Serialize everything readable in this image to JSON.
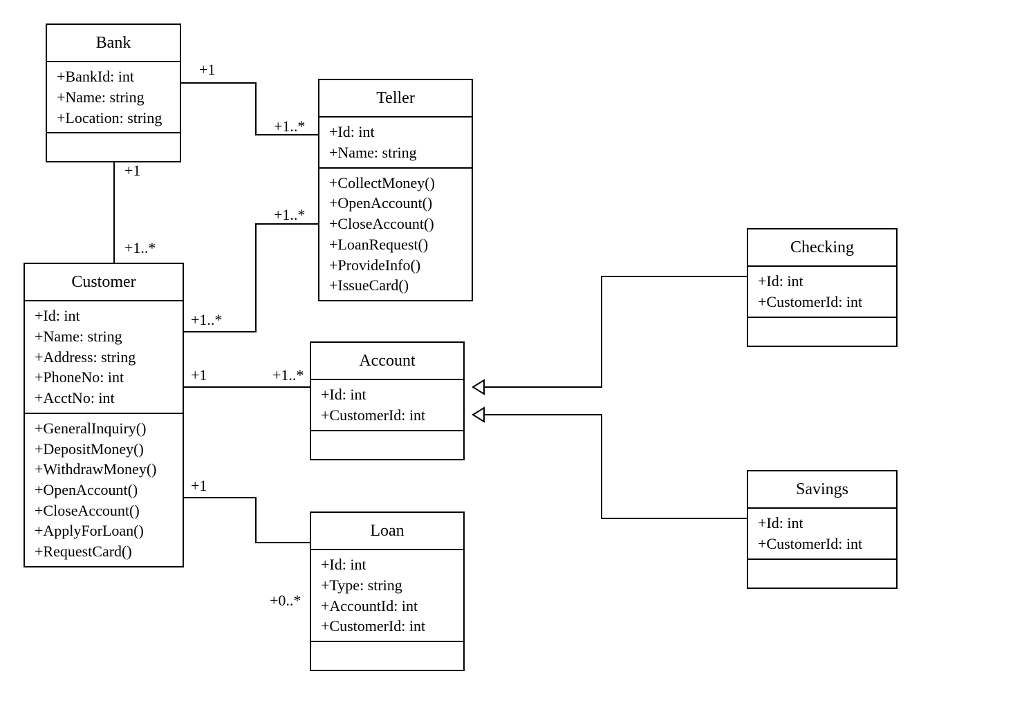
{
  "diagram_type": "UML class diagram",
  "classes": {
    "bank": {
      "name": "Bank",
      "attributes": [
        "+BankId: int",
        "+Name: string",
        "+Location: string"
      ],
      "operations": []
    },
    "teller": {
      "name": "Teller",
      "attributes": [
        "+Id: int",
        "+Name: string"
      ],
      "operations": [
        "+CollectMoney()",
        "+OpenAccount()",
        "+CloseAccount()",
        "+LoanRequest()",
        "+ProvideInfo()",
        "+IssueCard()"
      ]
    },
    "customer": {
      "name": "Customer",
      "attributes": [
        "+Id: int",
        "+Name: string",
        "+Address: string",
        "+PhoneNo: int",
        "+AcctNo: int"
      ],
      "operations": [
        "+GeneralInquiry()",
        "+DepositMoney()",
        "+WithdrawMoney()",
        "+OpenAccount()",
        "+CloseAccount()",
        "+ApplyForLoan()",
        "+RequestCard()"
      ]
    },
    "account": {
      "name": "Account",
      "attributes": [
        "+Id: int",
        "+CustomerId: int"
      ],
      "operations": []
    },
    "loan": {
      "name": "Loan",
      "attributes": [
        "+Id: int",
        "+Type: string",
        "+AccountId: int",
        "+CustomerId: int"
      ],
      "operations": []
    },
    "checking": {
      "name": "Checking",
      "attributes": [
        "+Id: int",
        "+CustomerId: int"
      ],
      "operations": []
    },
    "savings": {
      "name": "Savings",
      "attributes": [
        "+Id: int",
        "+CustomerId: int"
      ],
      "operations": []
    }
  },
  "multiplicities": {
    "bank_teller_bank": "+1",
    "bank_teller_teller": "+1..*",
    "bank_customer_bank": "+1",
    "bank_customer_customer": "+1..*",
    "customer_teller_customer": "+1..*",
    "customer_teller_teller": "+1..*",
    "customer_account_customer": "+1",
    "customer_account_account": "+1..*",
    "customer_loan_customer": "+1",
    "customer_loan_loan": "+0..*"
  },
  "relationships": [
    {
      "from": "Bank",
      "to": "Teller",
      "type": "association",
      "from_mult": "+1",
      "to_mult": "+1..*"
    },
    {
      "from": "Bank",
      "to": "Customer",
      "type": "association",
      "from_mult": "+1",
      "to_mult": "+1..*"
    },
    {
      "from": "Customer",
      "to": "Teller",
      "type": "association",
      "from_mult": "+1..*",
      "to_mult": "+1..*"
    },
    {
      "from": "Customer",
      "to": "Account",
      "type": "association",
      "from_mult": "+1",
      "to_mult": "+1..*"
    },
    {
      "from": "Customer",
      "to": "Loan",
      "type": "association",
      "from_mult": "+1",
      "to_mult": "+0..*"
    },
    {
      "from": "Checking",
      "to": "Account",
      "type": "generalization"
    },
    {
      "from": "Savings",
      "to": "Account",
      "type": "generalization"
    }
  ]
}
